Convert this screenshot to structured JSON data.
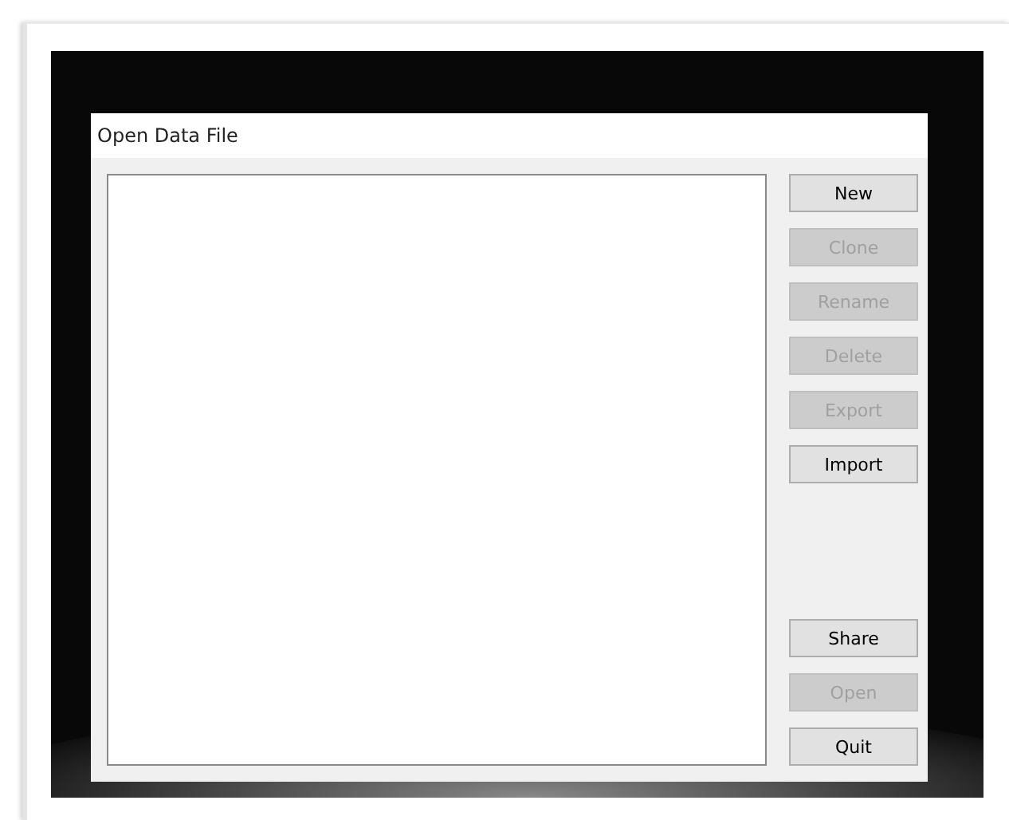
{
  "dialog": {
    "title": "Open Data File"
  },
  "top_buttons": [
    {
      "label": "New",
      "disabled": false
    },
    {
      "label": "Clone",
      "disabled": true
    },
    {
      "label": "Rename",
      "disabled": true
    },
    {
      "label": "Delete",
      "disabled": true
    },
    {
      "label": "Export",
      "disabled": true
    },
    {
      "label": "Import",
      "disabled": false
    }
  ],
  "bottom_buttons": [
    {
      "label": "Share",
      "disabled": false
    },
    {
      "label": "Open",
      "disabled": true
    },
    {
      "label": "Quit",
      "disabled": false
    }
  ]
}
